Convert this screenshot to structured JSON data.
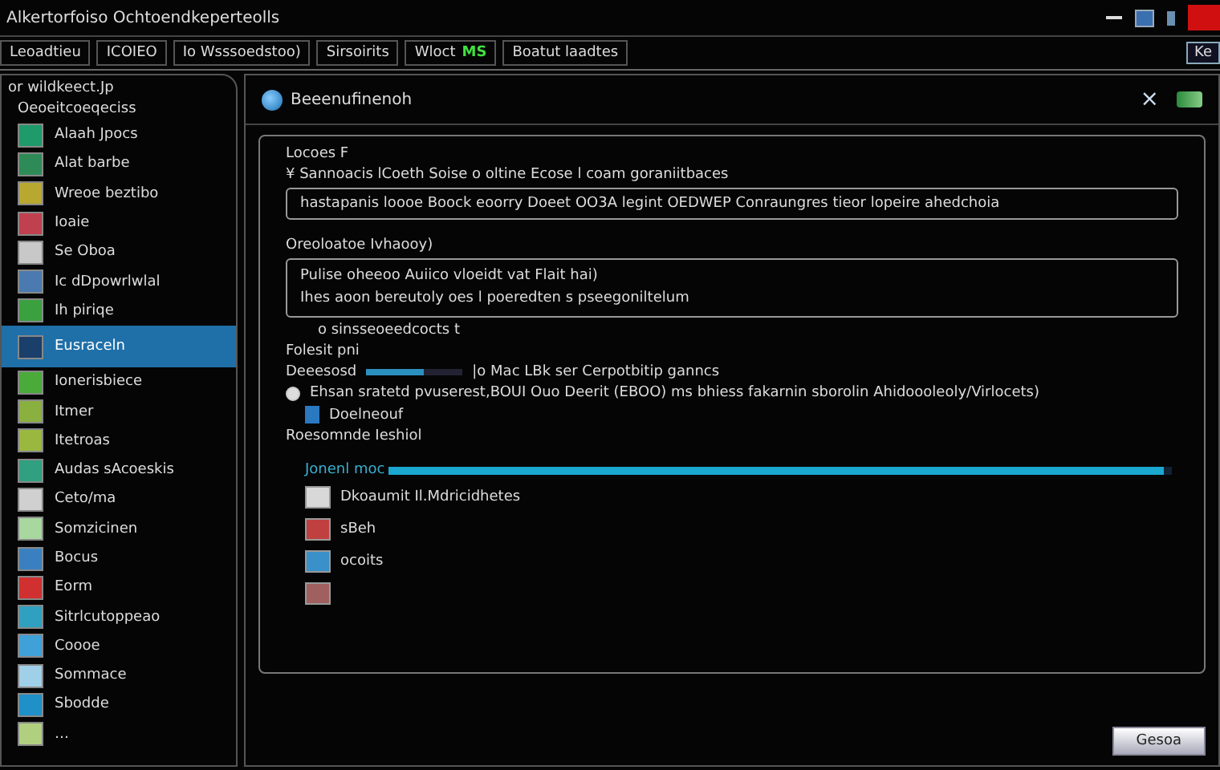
{
  "window": {
    "title": "Alkertorfoiso Ochtoendkeperteolls"
  },
  "toolbar": {
    "items": [
      {
        "label": "Leoadtieu"
      },
      {
        "label": "ICOIEO"
      },
      {
        "label": "Io Wsssoedstoo)"
      },
      {
        "label": "Sirsoirits"
      },
      {
        "label": "Wloct",
        "badge": "MS"
      },
      {
        "label": "Boatut laadtes"
      }
    ],
    "right_label": "Ke"
  },
  "sidebar": {
    "heading": "or wildkeect.Jp",
    "subheading": "Oeoeitcoeqeciss",
    "items": [
      {
        "label": "Alaah Jpocs",
        "selected": false,
        "color": "#1f9a6a"
      },
      {
        "label": "Alat barbe",
        "selected": false,
        "color": "#2e8b57"
      },
      {
        "label": "Wreoe beztibo",
        "selected": false,
        "color": "#b8a830"
      },
      {
        "label": "Ioaie",
        "selected": false,
        "color": "#c04050"
      },
      {
        "label": "Se Oboa",
        "selected": false,
        "color": "#c8c8c8"
      },
      {
        "label": "Ic dDpowrlwlal",
        "selected": false,
        "color": "#4a7ab0"
      },
      {
        "label": "Ih piriqe",
        "selected": false,
        "color": "#3aa040"
      },
      {
        "label": "Eusraceln",
        "selected": true,
        "color": "#1a3f6a"
      },
      {
        "label": "Ionerisbiece",
        "selected": false,
        "color": "#4aaa3a"
      },
      {
        "label": "Itmer",
        "selected": false,
        "color": "#8ab040"
      },
      {
        "label": "Itetroas",
        "selected": false,
        "color": "#9ab840"
      },
      {
        "label": "Audas sAcoeskis",
        "selected": false,
        "color": "#30a080"
      },
      {
        "label": "Ceto/ma",
        "selected": false,
        "color": "#d0d0d0"
      },
      {
        "label": "Somzicinen",
        "selected": false,
        "color": "#a8d8a0"
      },
      {
        "label": "Bocus",
        "selected": false,
        "color": "#3a80c0"
      },
      {
        "label": "Eorm",
        "selected": false,
        "color": "#d03030"
      },
      {
        "label": "Sitrlcutoppeao",
        "selected": false,
        "color": "#30a0c0"
      },
      {
        "label": "Coooe",
        "selected": false,
        "color": "#40a0d8"
      },
      {
        "label": "Sommace",
        "selected": false,
        "color": "#a0d0e8"
      },
      {
        "label": "Sbodde",
        "selected": false,
        "color": "#2090c8"
      },
      {
        "label": "…",
        "selected": false,
        "color": "#b0d080"
      }
    ]
  },
  "panel": {
    "title": "Beeenufinenoh",
    "close": "×",
    "section": "Locoes F",
    "line_1": "¥ Sannoacis lCoeth   Soise o oltine Ecose  l coam goraniitbaces",
    "field_1": "hastapanis loooe Boock eoorry Doeet OO3A  legint OEDWEP  Conraungres tieor lopeire ahedchoia",
    "label_2": "Oreoloatoe Ivhaooy)",
    "field_2": [
      "Pulise oheeoo Auiico vloeidt vat Flait hai)",
      "Ihes aoon bereutoly oes l poeredten s pseegoniltelum"
    ],
    "note": "o sinsseoeedcocts t",
    "label_3": "Folesit pni",
    "slider": {
      "label": "Deeesosd",
      "level": 0.6,
      "text": "|o  Mac LBk ser Cerpotbitip ganncs"
    },
    "radio": {
      "selected": true,
      "label": "Ehsan sratetd pvuserest,BOUI Ouo Deerit (EBOO) ms bhiess fakarnin sborolin Ahidoooleoly/Virlocets)"
    },
    "file": "Doelneouf",
    "label_4": "Roesomnde Ieshiol",
    "progress": {
      "label": "Jonenl moc",
      "level": 0.99
    },
    "list": [
      {
        "label": "Dkoaumit Il.Mdricidhetes",
        "color": "#d8d8d8"
      },
      {
        "label": "sBeh",
        "color": "#c04040"
      },
      {
        "label": "ocoits",
        "color": "#3a90c8"
      },
      {
        "color": "#a06060"
      }
    ],
    "button": "Gesoa"
  }
}
